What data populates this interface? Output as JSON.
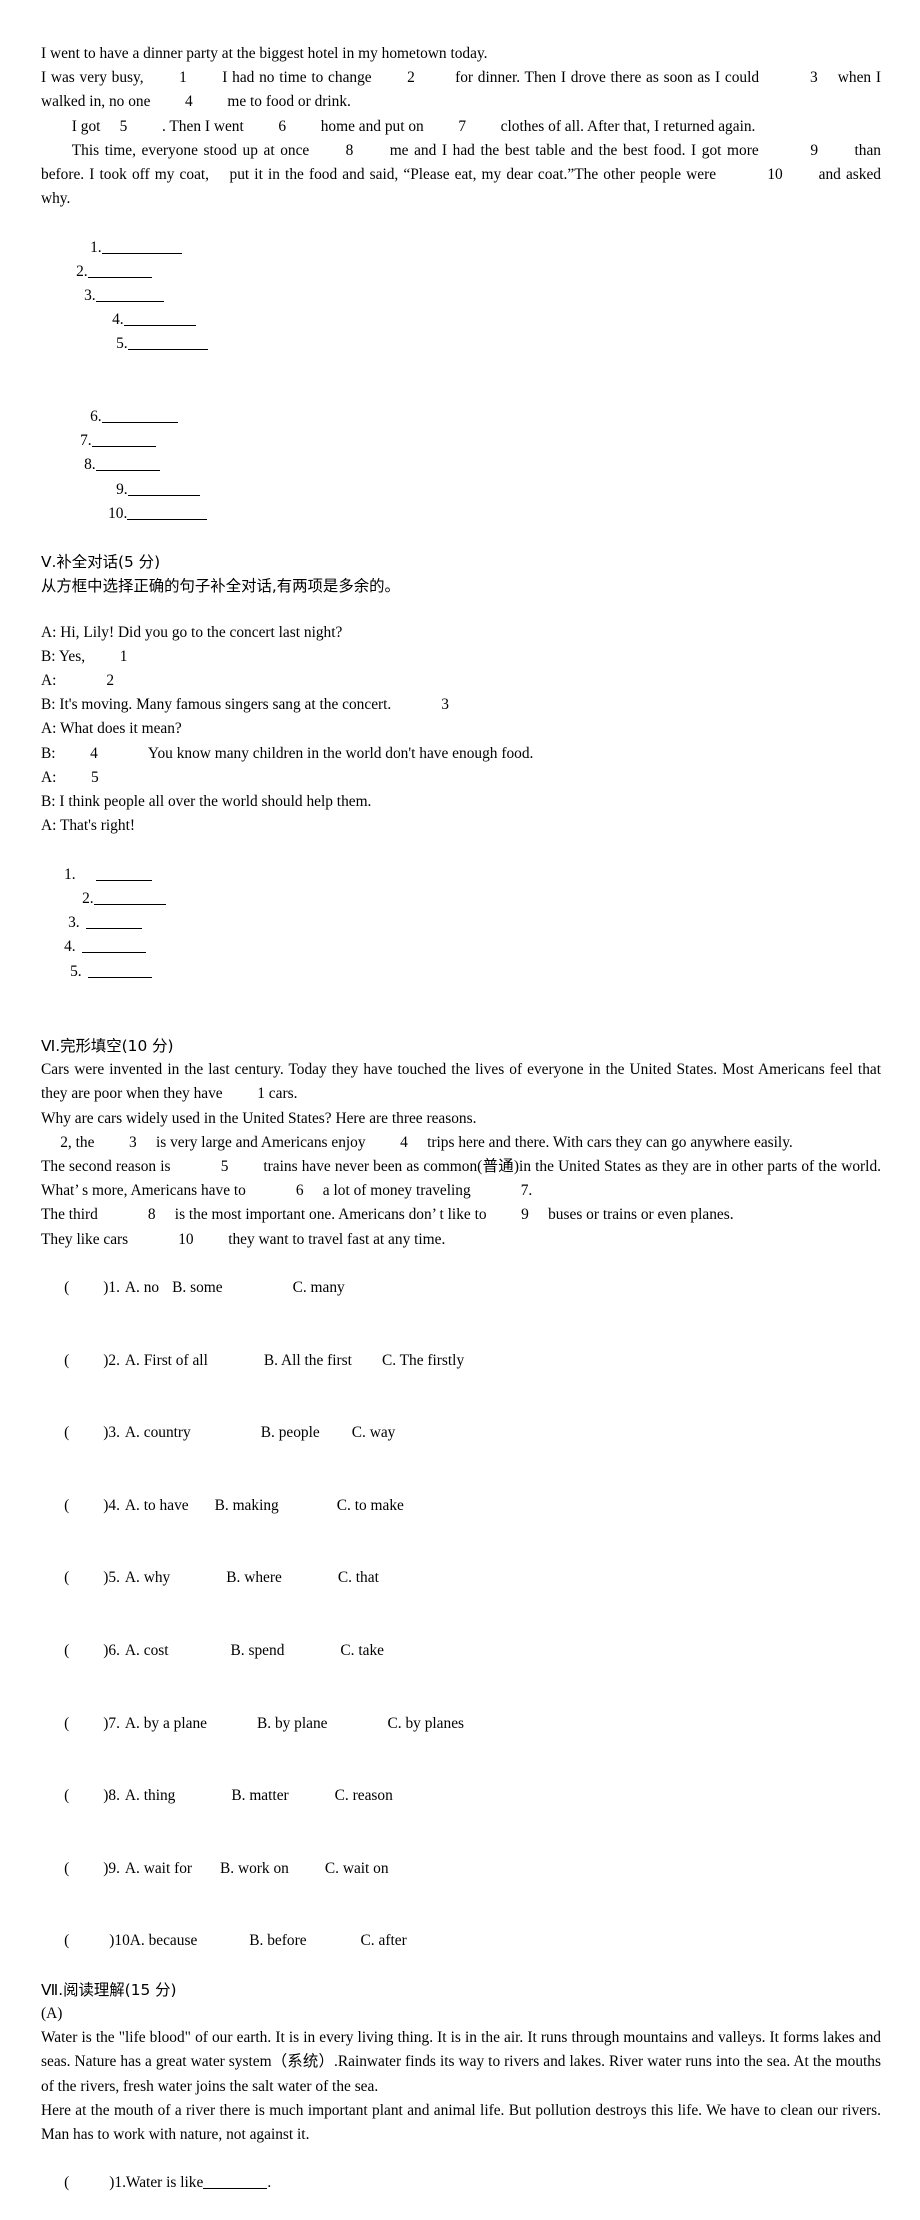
{
  "document": {
    "title": "English exam worksheet page"
  },
  "passage_fill": {
    "lines": [
      "I went to have a dinner party at the biggest hotel in my hometown today.",
      "I was very busy,   1   I had no time to change   2    for dinner. Then I drove there as soon as I could    3  when I walked in, no one   4   me to food or drink.",
      "  I got  5   . Then I went   6   home and put on   7   clothes of all. After that, I returned again.",
      "  This time, everyone stood up at once   8   me and I had the best table and the best food. I got more    9   than before. I took off my coat,  put it in the food and said, “Please eat, my dear coat.”The other people were    10   and asked why."
    ],
    "answer_rows": [
      [
        "1.",
        "2.",
        "3.",
        "4.",
        "5."
      ],
      [
        "6.",
        "7.",
        "8.",
        "9.",
        "10."
      ]
    ]
  },
  "section_v": {
    "heading": "Ⅴ.补全对话(5 分)",
    "instruction": "从方框中选择正确的句子补全对话,有两项是多余的。",
    "dialogue": [
      "A: Hi, Lily! Did you go to the concert last night?",
      "B: Yes,   1",
      "A:    2",
      "B: It's moving. Many famous singers sang at the concert.    3",
      "A: What does it mean?",
      "B:   4    You know many children in the world don't have enough food.",
      "A:   5",
      "B: I think people all over the world should help them.",
      "A: That's right!"
    ],
    "answer_labels": [
      "1.",
      "2.",
      "3.",
      "4.",
      "5."
    ]
  },
  "section_vi": {
    "heading": "Ⅵ.完形填空(10 分)",
    "passage": [
      "Cars were invented in the last century. Today they have touched the lives of everyone in the United States. Most Americans feel that they are poor when they have   1 cars.",
      "Why are cars widely used in the United States? Here are three reasons.",
      "  2, the   3  is very large and Americans enjoy   4  trips here and there. With cars they can go anywhere easily.",
      "The second reason is    5   trains have never been as common(普通)in the United States as they are in other parts of the world. What’ s more, Americans have to    6  a lot of money traveling    7.",
      "The third    8  is the most important one. Americans don’ t like to   9  buses or trains or even planes.",
      "They like cars    10   they want to travel fast at any time."
    ],
    "options": [
      {
        "num": "1.",
        "a": "A. no",
        "b": "B. some",
        "c": "C. many"
      },
      {
        "num": "2.",
        "a": "A. First of all",
        "b": "B. All the first",
        "c": "C. The firstly"
      },
      {
        "num": "3.",
        "a": "A. country",
        "b": "B. people",
        "c": "C. way"
      },
      {
        "num": "4.",
        "a": "A. to have",
        "b": "B. making",
        "c": "C. to make"
      },
      {
        "num": "5.",
        "a": "A. why",
        "b": "B. where",
        "c": "C. that"
      },
      {
        "num": "6.",
        "a": "A. cost",
        "b": "B. spend",
        "c": "C. take"
      },
      {
        "num": "7.",
        "a": "A. by a plane",
        "b": "B. by plane",
        "c": "C. by planes"
      },
      {
        "num": "8.",
        "a": "A. thing",
        "b": "B. matter",
        "c": "C. reason"
      },
      {
        "num": "9.",
        "a": "A. wait for",
        "b": "B. work on",
        "c": "C. wait on"
      },
      {
        "num": "10",
        "a": "A. because",
        "b": "B. before",
        "c": "C. after"
      }
    ],
    "paren_open": "(",
    "paren_close": ")"
  },
  "section_vii": {
    "heading": "Ⅶ.阅读理解(15 分)",
    "part_label": "(A)",
    "passage": [
      "Water is the \"life blood\" of our earth. It is in every living thing. It is in the air. It runs through mountains and valleys. It forms lakes and seas. Nature has a great water system（系统）.Rainwater finds its way to rivers and lakes. River water runs into the sea. At the mouths of the rivers, fresh water joins the salt water of the sea.",
      "Here at the mouth of a river there is much important plant and animal life. But pollution destroys this life. We have to clean our rivers. Man has to work with nature, not against it."
    ],
    "question_1": {
      "paren_open": "(",
      "paren_close": ")",
      "text_before": "1.Water is like",
      "text_after": "."
    }
  }
}
